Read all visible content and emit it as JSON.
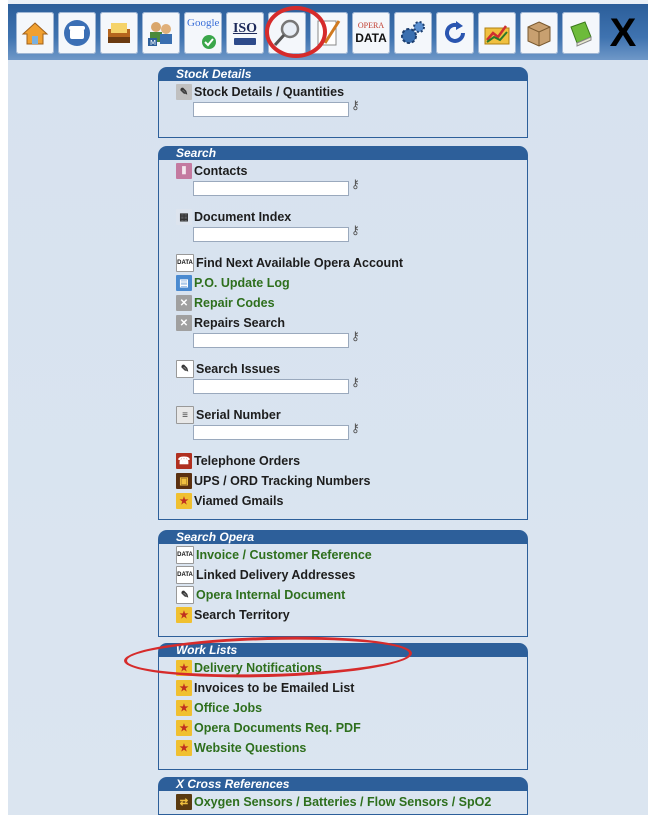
{
  "toolbar": {
    "buttons": [
      {
        "name": "home-icon",
        "label": ""
      },
      {
        "name": "phone-icon",
        "label": ""
      },
      {
        "name": "folder-tray-icon",
        "label": ""
      },
      {
        "name": "users-icon",
        "label": "M"
      },
      {
        "name": "google-icon",
        "label": "Google"
      },
      {
        "name": "iso-icon",
        "label": "ISO"
      },
      {
        "name": "magnifier-icon",
        "label": ""
      },
      {
        "name": "pencil-icon",
        "label": ""
      },
      {
        "name": "opera-data-icon",
        "label": "DATA"
      },
      {
        "name": "gears-icon",
        "label": ""
      },
      {
        "name": "refresh-icon",
        "label": ""
      },
      {
        "name": "chart-folder-icon",
        "label": ""
      },
      {
        "name": "box-icon",
        "label": ""
      },
      {
        "name": "book-icon",
        "label": ""
      },
      {
        "name": "close-icon",
        "label": "X"
      }
    ],
    "opera_small": "OPERA"
  },
  "panels": {
    "stock": {
      "title": "Stock Details",
      "items": [
        {
          "label": "Stock Details / Quantities",
          "icon": "stock-icon"
        }
      ]
    },
    "search": {
      "title": "Search",
      "items": [
        {
          "label": "Contacts",
          "icon": "contacts-icon"
        },
        {
          "label": "Document Index",
          "icon": "document-index-icon"
        },
        {
          "label": "Find Next Available Opera Account",
          "icon": "opera-data-icon"
        },
        {
          "label": "P.O. Update Log",
          "icon": "log-icon"
        },
        {
          "label": "Repair Codes",
          "icon": "tools-icon"
        },
        {
          "label": "Repairs Search",
          "icon": "tools-icon"
        },
        {
          "label": "Search Issues",
          "icon": "pencil-icon"
        },
        {
          "label": "Serial Number",
          "icon": "serial-icon"
        },
        {
          "label": "Telephone Orders",
          "icon": "telephone-icon"
        },
        {
          "label": "UPS / ORD Tracking Numbers",
          "icon": "ups-icon"
        },
        {
          "label": "Viamed Gmails",
          "icon": "star-icon"
        }
      ]
    },
    "search_opera": {
      "title": "Search Opera",
      "items": [
        {
          "label": "Invoice / Customer Reference",
          "icon": "opera-data-icon"
        },
        {
          "label": "Linked Delivery Addresses",
          "icon": "opera-data-icon"
        },
        {
          "label": "Opera Internal Document",
          "icon": "pencil-icon"
        },
        {
          "label": "Search Territory",
          "icon": "star-icon"
        }
      ]
    },
    "work_lists": {
      "title": "Work Lists",
      "items": [
        {
          "label": "Delivery Notifications",
          "icon": "star-icon"
        },
        {
          "label": "Invoices to be Emailed List",
          "icon": "star-icon"
        },
        {
          "label": "Office Jobs",
          "icon": "star-icon"
        },
        {
          "label": "Opera Documents Req. PDF",
          "icon": "star-icon"
        },
        {
          "label": "Website Questions",
          "icon": "star-icon"
        }
      ]
    },
    "x_cross": {
      "title": "X Cross References",
      "items": [
        {
          "label": "Oxygen Sensors / Batteries / Flow Sensors / SpO2",
          "icon": "cross-ref-icon"
        }
      ]
    }
  },
  "colors": {
    "accent": "#2d5f9a",
    "link_green": "#2e6f1d",
    "highlight_red": "#d62b2b"
  }
}
